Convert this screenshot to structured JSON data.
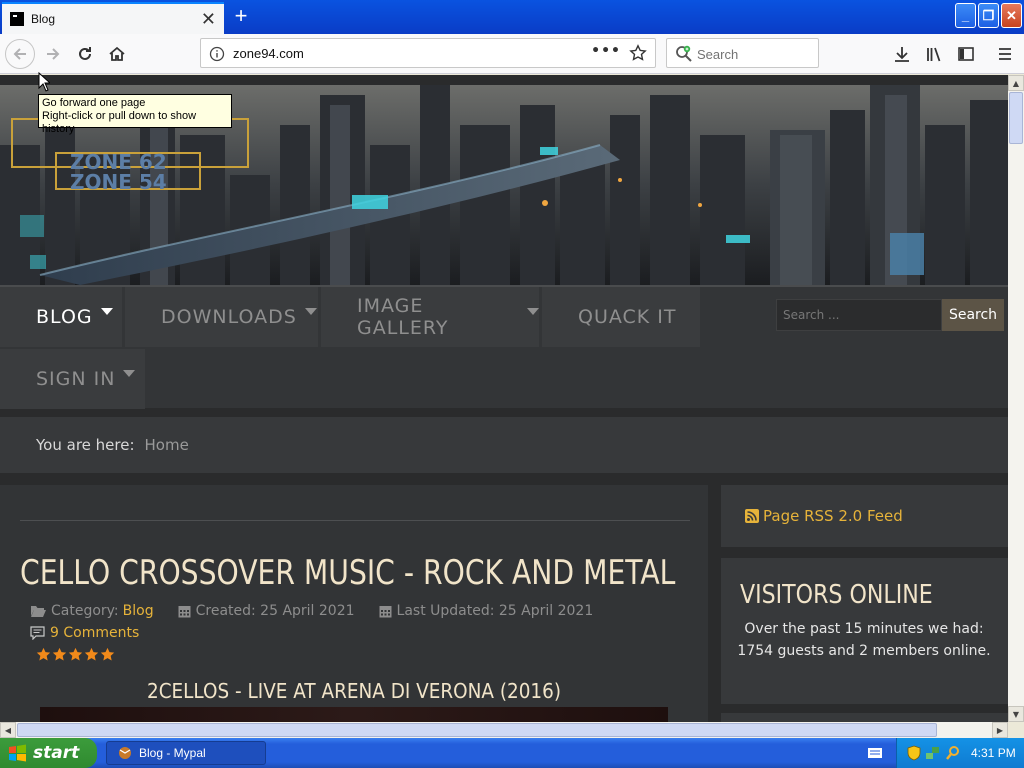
{
  "browser": {
    "tab_title": "Blog",
    "tab_close": "✕",
    "new_tab": "+",
    "url": "zone94.com",
    "url_more": "•••",
    "search_placeholder": "Search",
    "window_buttons": {
      "minimize": "_",
      "maximize": "❐",
      "close": "✕"
    },
    "tooltip": {
      "line1": "Go forward one page",
      "line2": "Right-click or pull down to show history"
    }
  },
  "banner": {
    "logo_lines": [
      "ZONE 62",
      "ZONE 54"
    ]
  },
  "menu": {
    "items": [
      {
        "label": "BLOG",
        "caret": true,
        "active": true
      },
      {
        "label": "DOWNLOADS",
        "caret": true,
        "active": false
      },
      {
        "label": "IMAGE GALLERY",
        "caret": true,
        "active": false
      },
      {
        "label": "QUACK IT",
        "caret": false,
        "active": false
      },
      {
        "label": "SIGN IN",
        "caret": true,
        "active": false
      }
    ],
    "search_placeholder": "Search ...",
    "search_button": "Search"
  },
  "breadcrumb": {
    "prefix": "You are here:",
    "home": "Home"
  },
  "article": {
    "title": "CELLO CROSSOVER MUSIC - ROCK AND METAL",
    "category_label": "Category:",
    "category": "Blog",
    "created": "Created: 25 April 2021",
    "updated": "Last Updated: 25 April 2021",
    "comments": "9 Comments",
    "rating_stars": 5,
    "video_title": "2CELLOS - LIVE AT ARENA DI VERONA (2016)"
  },
  "sidebar": {
    "rss": "Page RSS 2.0 Feed",
    "visitors_title": "VISITORS ONLINE",
    "visitors_text": "Over the past 15 minutes we had: 1754 guests and 2 members online."
  },
  "taskbar": {
    "start": "start",
    "task": "Blog - Mypal",
    "clock": "4:31 PM"
  },
  "colors": {
    "accent": "#e6b33a",
    "heading": "#f1e4c9",
    "page_bg": "#2a2b2c",
    "panel_bg": "#37393b",
    "firefox_blue": "#0a84ff",
    "star_orange": "#f28a1a"
  }
}
